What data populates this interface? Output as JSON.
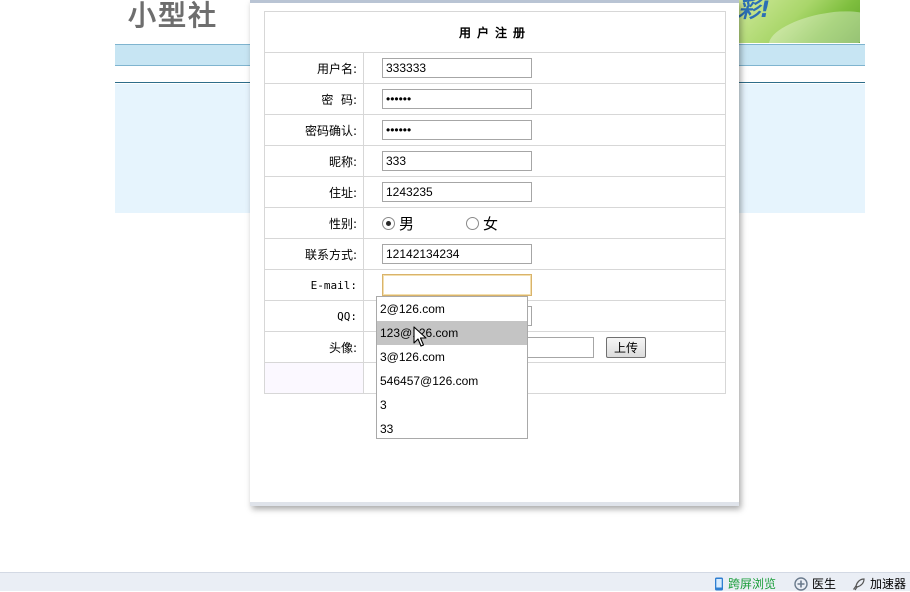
{
  "background": {
    "logo_text": "小型社",
    "banner_text": "彩!"
  },
  "form": {
    "title": "用户注册",
    "fields": {
      "username": {
        "label": "用户名:",
        "value": "333333"
      },
      "password": {
        "label": "密  码:",
        "value": "••••••"
      },
      "password_confirm": {
        "label": "密码确认:",
        "value": "••••••"
      },
      "nickname": {
        "label": "昵称:",
        "value": "333"
      },
      "address": {
        "label": "住址:",
        "value": "1243235"
      },
      "gender": {
        "label": "性别:",
        "options": [
          "男",
          "女"
        ],
        "selected": "男"
      },
      "contact": {
        "label": "联系方式:",
        "value": "12142134234"
      },
      "email": {
        "label": "E-mail:",
        "value": ""
      },
      "qq": {
        "label": "QQ:",
        "value": ""
      },
      "avatar": {
        "label": "头像:",
        "upload_label": "上传"
      }
    }
  },
  "autocomplete": {
    "items": [
      "2@126.com",
      "123@126.com",
      "3@126.com",
      "546457@126.com",
      "3",
      "33"
    ],
    "highlighted": "123@126.com"
  },
  "statusbar": {
    "items": [
      {
        "label": "跨屏浏览",
        "icon": "phone-icon",
        "color": "#1a9e3a"
      },
      {
        "label": "医生",
        "icon": "doctor-icon",
        "color": "#000000"
      },
      {
        "label": "加速器",
        "icon": "rocket-icon",
        "color": "#000000"
      }
    ]
  }
}
